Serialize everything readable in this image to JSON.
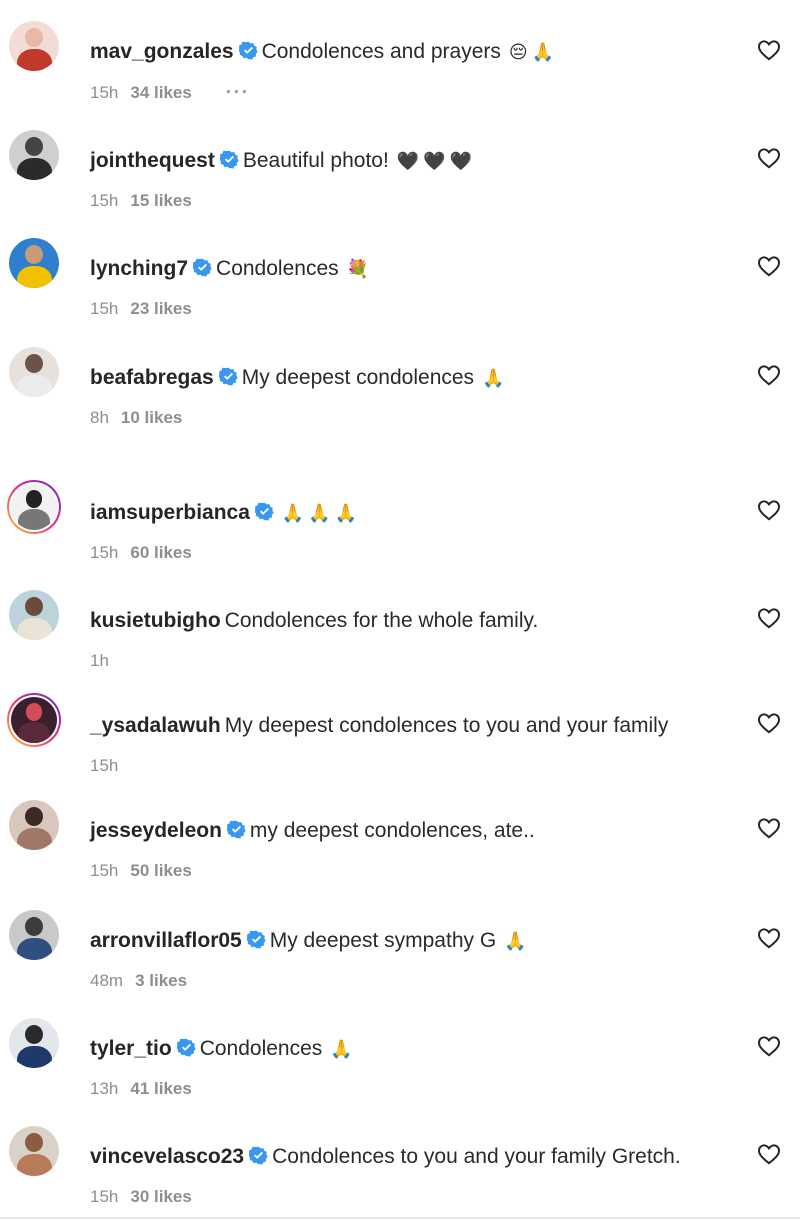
{
  "comments": [
    {
      "username": "mav_gonzales",
      "verified": true,
      "text": "Condolences and prayers",
      "emoji": "😔🙏",
      "time": "15h",
      "likes": "34 likes",
      "more": "···",
      "avatar": {
        "bg": "#f3dcd6",
        "head": "#e8b9a4",
        "torso": "#c0392b",
        "ring": false
      }
    },
    {
      "username": "jointhequest",
      "verified": true,
      "text": "Beautiful photo!",
      "emoji": "🖤🖤🖤",
      "time": "15h",
      "likes": "15 likes",
      "avatar": {
        "bg": "#cfcfcf",
        "head": "#444444",
        "torso": "#2b2b2b",
        "ring": false
      }
    },
    {
      "username": "lynching7",
      "verified": true,
      "text": "Condolences",
      "emoji": "💐",
      "time": "15h",
      "likes": "23 likes",
      "avatar": {
        "bg": "#2e7fd0",
        "head": "#c99a78",
        "torso": "#f2c200",
        "ring": false
      }
    },
    {
      "username": "beafabregas",
      "verified": true,
      "text": "My deepest condolences",
      "emoji": "🙏",
      "time": "8h",
      "likes": "10 likes",
      "avatar": {
        "bg": "#e6e1dc",
        "head": "#6b5446",
        "torso": "#ececec",
        "ring": false
      }
    },
    {
      "username": "iamsuperbianca",
      "verified": true,
      "text": "",
      "emoji": "🙏🙏🙏",
      "time": "15h",
      "likes": "60 likes",
      "avatar": {
        "bg": "#f2f2f2",
        "head": "#222222",
        "torso": "#777777",
        "ring": true
      }
    },
    {
      "username": "kusietubigho",
      "verified": false,
      "text": "Condolences for the whole family.",
      "emoji": "",
      "time": "1h",
      "likes": "",
      "avatar": {
        "bg": "#bcd3dc",
        "head": "#6b4b3a",
        "torso": "#eae4d6",
        "ring": false
      }
    },
    {
      "username": "_ysadalawuh",
      "verified": false,
      "text": "My deepest condolences to you and your family",
      "emoji": "",
      "time": "15h",
      "likes": "",
      "avatar": {
        "bg": "#3a1f2e",
        "head": "#d24d57",
        "torso": "#5a2a3a",
        "ring": true
      }
    },
    {
      "username": "jesseydeleon",
      "verified": true,
      "text": "my deepest condolences, ate..",
      "emoji": "",
      "time": "15h",
      "likes": "50 likes",
      "avatar": {
        "bg": "#d8c7bd",
        "head": "#3b2a24",
        "torso": "#a07868",
        "ring": false
      }
    },
    {
      "username": "arronvillaflor05",
      "verified": true,
      "text": "My deepest sympathy G",
      "emoji": "🙏",
      "time": "48m",
      "likes": "3 likes",
      "avatar": {
        "bg": "#c9c9c9",
        "head": "#3d3d3d",
        "torso": "#2f4f7f",
        "ring": false
      }
    },
    {
      "username": "tyler_tio",
      "verified": true,
      "text": "Condolences",
      "emoji": "🙏",
      "time": "13h",
      "likes": "41 likes",
      "avatar": {
        "bg": "#e3e6ea",
        "head": "#2a2a2a",
        "torso": "#1f3a6a",
        "ring": false
      }
    },
    {
      "username": "vincevelasco23",
      "verified": true,
      "text": "Condolences to you and your family Gretch.",
      "emoji": "",
      "time": "15h",
      "likes": "30 likes",
      "avatar": {
        "bg": "#d9d2c8",
        "head": "#8a5c42",
        "torso": "#b97a5a",
        "ring": false
      }
    }
  ],
  "icons": {
    "verified": "verified-badge-icon",
    "like": "heart-outline-icon"
  },
  "colors": {
    "verified_badge": "#3897f0",
    "meta_text": "#8e8e8e",
    "username": "#262626"
  }
}
